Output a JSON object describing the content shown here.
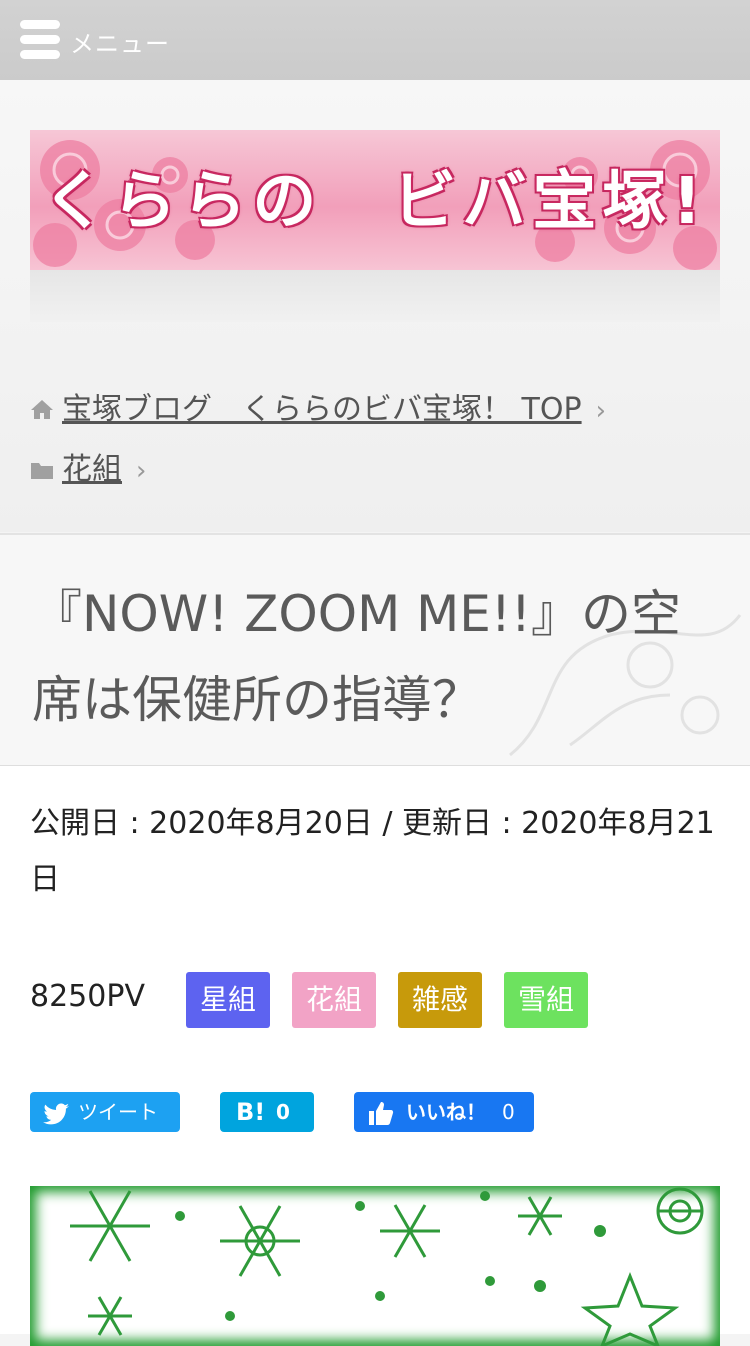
{
  "header": {
    "menu_label": "メニュー",
    "banner_title": "くららの　ビバ宝塚!"
  },
  "breadcrumb": {
    "home_label": "宝塚ブログ　くららのビバ宝塚！ TOP",
    "category_label": "花組"
  },
  "article": {
    "title": "『NOW! ZOOM ME!!』の空席は保健所の指導？",
    "dates": "公開日 : 2020年8月20日 / 更新日 : 2020年8月21日",
    "pageviews": "8250PV",
    "tags": [
      {
        "label": "星組",
        "color": "#5d63f0"
      },
      {
        "label": "花組",
        "color": "#f2a3c6"
      },
      {
        "label": "雑感",
        "color": "#c79a0b"
      },
      {
        "label": "雪組",
        "color": "#6de25f"
      }
    ]
  },
  "share": {
    "tweet_label": "ツイート",
    "tweet_color": "#1da1f2",
    "hatena_label": "B!",
    "hatena_count": "0",
    "hatena_color": "#00a4de",
    "like_label": "いいね！",
    "like_count": "0",
    "like_color": "#1877f2"
  },
  "icons": [
    "menu-icon",
    "home-icon",
    "folder-icon",
    "chevron-right-icon",
    "twitter-bird-icon",
    "thumbs-up-icon"
  ]
}
